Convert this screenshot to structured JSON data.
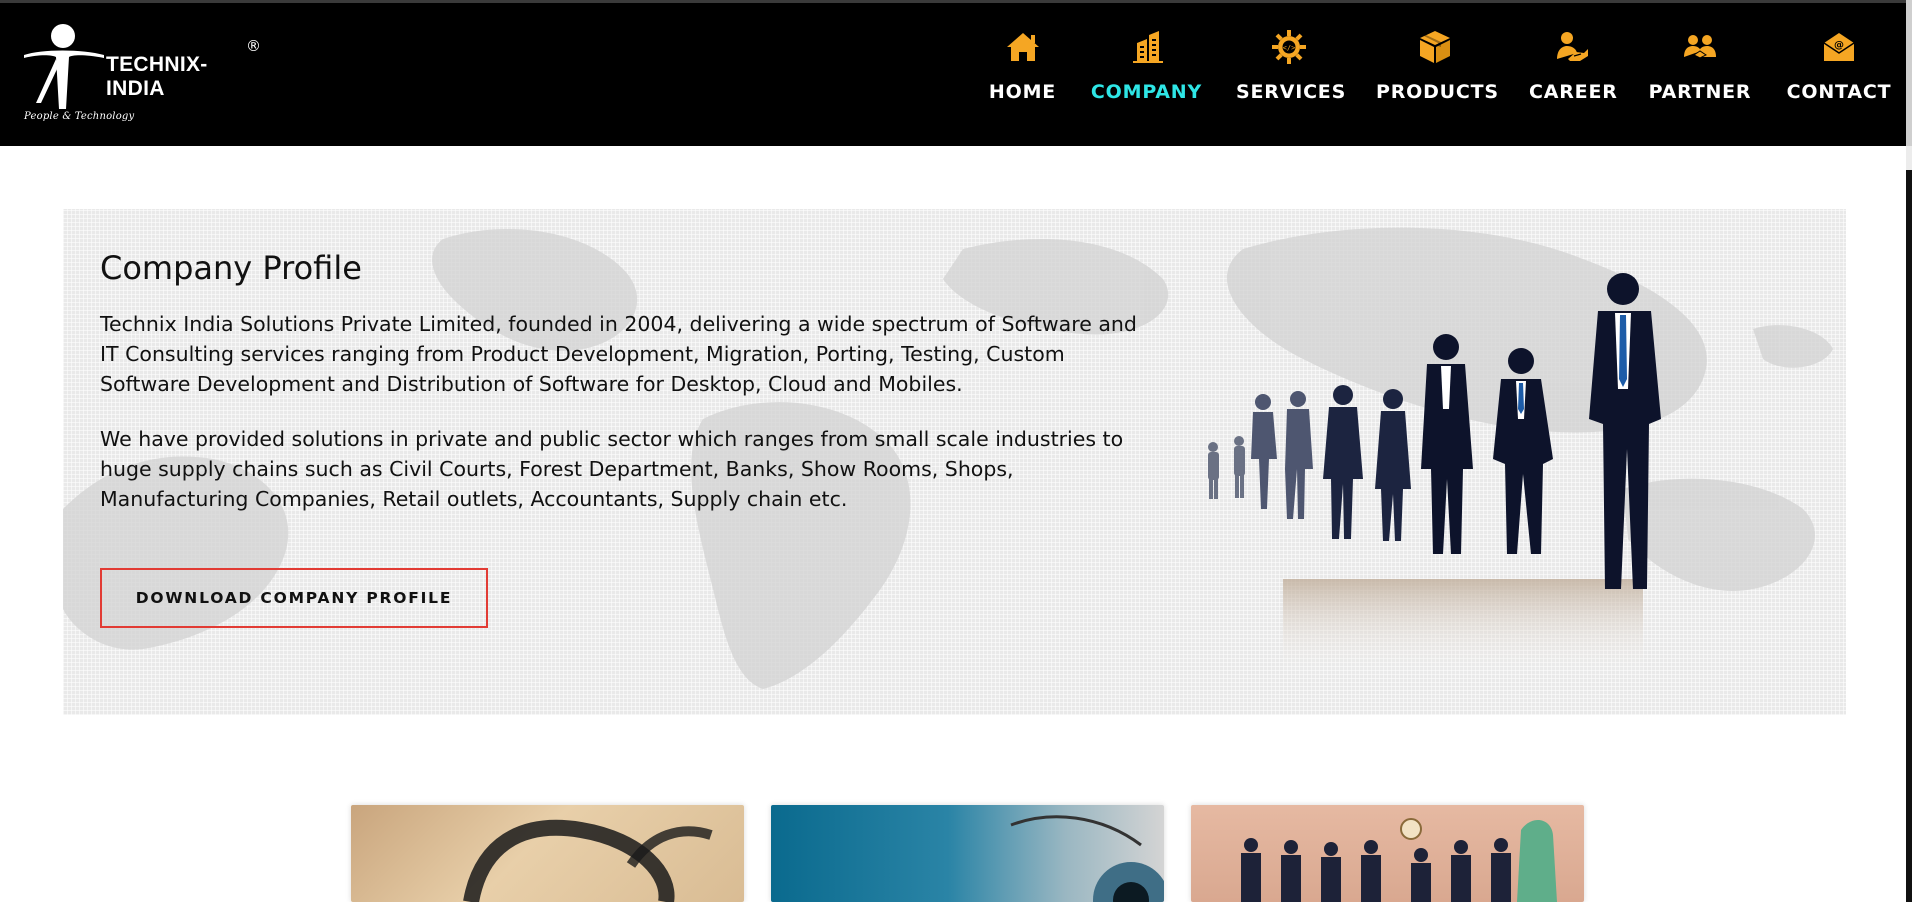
{
  "brand": {
    "name": "TECHNIX-INDIA",
    "registered": "®",
    "tagline": "People & Technology"
  },
  "nav": {
    "items": [
      {
        "label": "HOME",
        "icon": "home-icon",
        "active": false
      },
      {
        "label": "COMPANY",
        "icon": "building-icon",
        "active": true
      },
      {
        "label": "SERVICES",
        "icon": "gear-code-icon",
        "active": false
      },
      {
        "label": "PRODUCTS",
        "icon": "box-icon",
        "active": false
      },
      {
        "label": "CAREER",
        "icon": "person-handshake-icon",
        "active": false
      },
      {
        "label": "PARTNER",
        "icon": "partners-icon",
        "active": false
      },
      {
        "label": "CONTACT",
        "icon": "envelope-at-icon",
        "active": false
      }
    ],
    "icon_color": "#f5a623",
    "active_color": "#2ee6e6"
  },
  "hero": {
    "title": "Company Profile",
    "paragraph1": "Technix India Solutions Private Limited, founded in 2004, delivering a wide spectrum of Software and IT Consulting services ranging from Product Development, Migration, Porting, Testing, Custom Software Development and Distribution of Software for Desktop, Cloud and Mobiles.",
    "paragraph2": "We have provided solutions in private and public sector which ranges from small scale industries to huge supply chains such as Civil Courts, Forest Department, Banks, Show Rooms, Shops, Manufacturing Companies, Retail outlets, Accountants, Supply chain etc.",
    "button_label": "DOWNLOAD COMPANY PROFILE",
    "button_border_color": "#e23b34"
  },
  "cards": [
    {
      "image": "eyeglasses-photo"
    },
    {
      "image": "eye-closeup-photo"
    },
    {
      "image": "team-group-photo"
    }
  ]
}
